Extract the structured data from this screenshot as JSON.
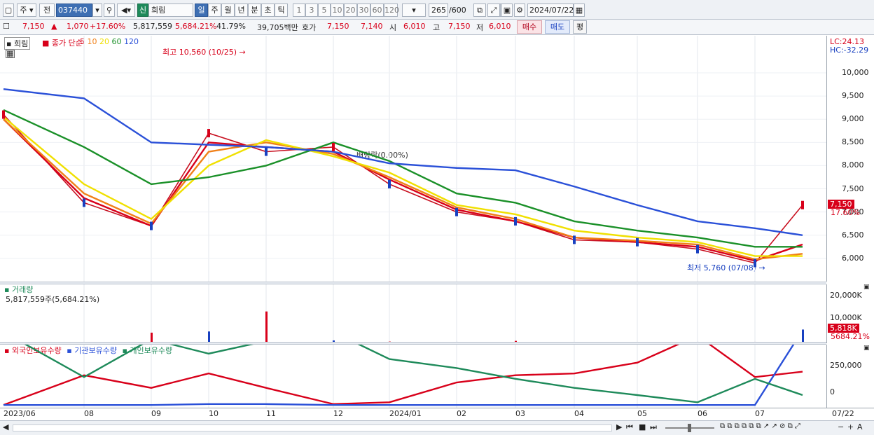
{
  "toolbar": {
    "type_label": "주",
    "prev_label": "전",
    "code": "037440",
    "stock_badge": "신",
    "stock_name": "희림",
    "periods": [
      "일",
      "주",
      "월",
      "년",
      "분",
      "초",
      "틱"
    ],
    "active_period": "일",
    "counts": [
      "1",
      "3",
      "5",
      "10",
      "20",
      "30",
      "60",
      "120"
    ],
    "bars_value": "265",
    "bars_total": "/600",
    "date": "2024/07/22"
  },
  "quote": {
    "price": "7,150",
    "change": "1,070",
    "change_rate": "+17.60%",
    "volume": "5,817,559",
    "volume_rate": "5,684.21%",
    "turnover": "41.79%",
    "amount": "39,705백만",
    "bid_label": "호가",
    "bid1": "7,150",
    "bid2": "7,140",
    "open_label": "시",
    "open": "6,010",
    "high_label": "고",
    "high": "7,150",
    "low_label": "저",
    "low": "6,010",
    "buy_label": "매수",
    "sell_label": "매도",
    "avg_label": "평"
  },
  "price_panel": {
    "name": "희림",
    "ma_label": "종가 단순",
    "ma_periods": [
      "5",
      "10",
      "20",
      "60",
      "120"
    ],
    "ma_colors": [
      "#d8001a",
      "#f08018",
      "#f0e000",
      "#1a9028",
      "#2a50d8"
    ],
    "high_note": "최고 10,560 (10/25)",
    "low_note": "최저 5,760 (07/08)",
    "dividend_note": "배당락(0.00%)",
    "lc": "LC:24.13",
    "hc": "HC:-32.29",
    "y_labels": [
      "10,000",
      "9,500",
      "9,000",
      "8,500",
      "8,000",
      "7,500",
      "7,000",
      "6,500",
      "6,000"
    ],
    "last_price": "7,150",
    "last_rate": "17.60%"
  },
  "volume_panel": {
    "title": "거래량",
    "value": "5,817,559주(5,684.21%)",
    "y_labels": [
      "20,000K",
      "10,000K"
    ],
    "last_volume": "5,818K",
    "last_rate": "5684.21%"
  },
  "holdings_panel": {
    "legend": [
      "외국인보유수량",
      "기관보유수량",
      "개인보유수량"
    ],
    "colors": [
      "#d8001a",
      "#2a50d8",
      "#1e8a5a"
    ],
    "y_labels": [
      "250,000",
      "0"
    ]
  },
  "x_axis": [
    "2023/06",
    "08",
    "09",
    "10",
    "11",
    "12",
    "2024/01",
    "02",
    "03",
    "04",
    "05",
    "06",
    "07",
    "07/22"
  ],
  "chart_data": [
    {
      "type": "line",
      "title": "희림",
      "ylabel": "",
      "ylim": [
        5500,
        10800
      ],
      "x": [
        "2023/06",
        "08",
        "09",
        "10",
        "11",
        "12",
        "2024/01",
        "02",
        "03",
        "04",
        "05",
        "06",
        "07",
        "07/22"
      ],
      "series": [
        {
          "name": "종가",
          "values": [
            9100,
            7200,
            6700,
            8700,
            8300,
            8400,
            7600,
            7000,
            6800,
            6400,
            6350,
            6200,
            5900,
            7150
          ]
        },
        {
          "name": "5",
          "values": [
            9000,
            7300,
            6700,
            8500,
            8400,
            8300,
            7700,
            7050,
            6800,
            6450,
            6350,
            6250,
            5950,
            6300
          ]
        },
        {
          "name": "10",
          "values": [
            9000,
            7400,
            6750,
            8300,
            8500,
            8250,
            7750,
            7100,
            6850,
            6450,
            6380,
            6300,
            5980,
            6100
          ]
        },
        {
          "name": "20",
          "values": [
            9050,
            7600,
            6850,
            8000,
            8550,
            8200,
            7850,
            7150,
            6950,
            6600,
            6450,
            6350,
            6050,
            6050
          ]
        },
        {
          "name": "60",
          "values": [
            9200,
            8400,
            7600,
            7750,
            8000,
            8500,
            8100,
            7400,
            7200,
            6800,
            6600,
            6450,
            6250,
            6250
          ]
        },
        {
          "name": "120",
          "values": [
            9650,
            9450,
            8500,
            8450,
            8400,
            8300,
            8050,
            7950,
            7900,
            7550,
            7150,
            6800,
            6650,
            6500
          ]
        }
      ]
    },
    {
      "type": "bar",
      "title": "거래량",
      "ylabel": "",
      "ylim": [
        0,
        25000
      ],
      "x": [
        "2023/06",
        "08",
        "09",
        "10",
        "11",
        "12",
        "2024/01",
        "02",
        "03",
        "04",
        "05",
        "06",
        "07",
        "07/22"
      ],
      "values": [
        250,
        300,
        4500,
        5000,
        13500,
        1200,
        700,
        600,
        1000,
        500,
        500,
        600,
        600,
        5818
      ]
    },
    {
      "type": "line",
      "title": "보유수량",
      "ylabel": "",
      "ylim": [
        -50000,
        300000
      ],
      "x": [
        "2023/06",
        "08",
        "09",
        "10",
        "11",
        "12",
        "2024/01",
        "02",
        "03",
        "04",
        "05",
        "06",
        "07",
        "07/22"
      ],
      "series": [
        {
          "name": "외국인보유수량",
          "values": [
            -35000,
            130000,
            60000,
            140000,
            60000,
            -30000,
            -20000,
            90000,
            130000,
            140000,
            200000,
            350000,
            120000,
            150000
          ]
        },
        {
          "name": "기관보유수량",
          "values": [
            -35000,
            -35000,
            -35000,
            -30000,
            -30000,
            -35000,
            -35000,
            -35000,
            -35000,
            -35000,
            -35000,
            -35000,
            -35000,
            380000
          ]
        },
        {
          "name": "개인보유수량",
          "values": [
            370000,
            120000,
            330000,
            250000,
            320000,
            370000,
            220000,
            170000,
            110000,
            60000,
            20000,
            -20000,
            110000,
            20000
          ]
        }
      ]
    }
  ]
}
